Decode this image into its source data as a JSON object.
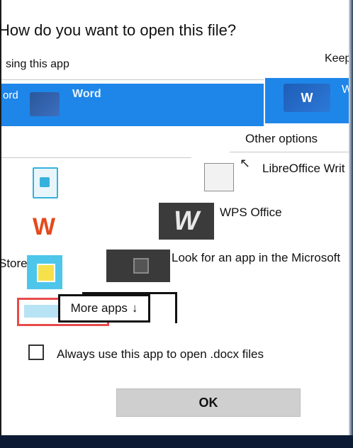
{
  "dialog": {
    "title": "How do you want to open this file?",
    "keep_using_left": "sing this app",
    "keep_using_right": "Keep u",
    "selected_app_left_label": "ord",
    "selected_app_name": "Word",
    "selected_app_right_label": "Word",
    "word_icon_glyph": "W",
    "other_options_label": "Other options",
    "apps": [
      {
        "name": "LibreOffice Writ",
        "icon": "libreoffice-icon"
      },
      {
        "name": "WPS Office",
        "icon": "wps-office-icon",
        "glyph": "W",
        "left_glyph": "W"
      },
      {
        "name": "Look for an app in the Microsoft",
        "icon": "microsoft-store-icon",
        "left_fragment": "Store"
      }
    ],
    "more_apps_label": "More apps",
    "more_apps_chevron": "↓",
    "always_use_label": "Always use this app to open .docx files",
    "always_use_checked": false,
    "ok_label": "OK",
    "colors": {
      "selection": "#1e86e8",
      "highlight_outline": "#e84a4a",
      "ok_button": "#cfcfcf"
    }
  }
}
